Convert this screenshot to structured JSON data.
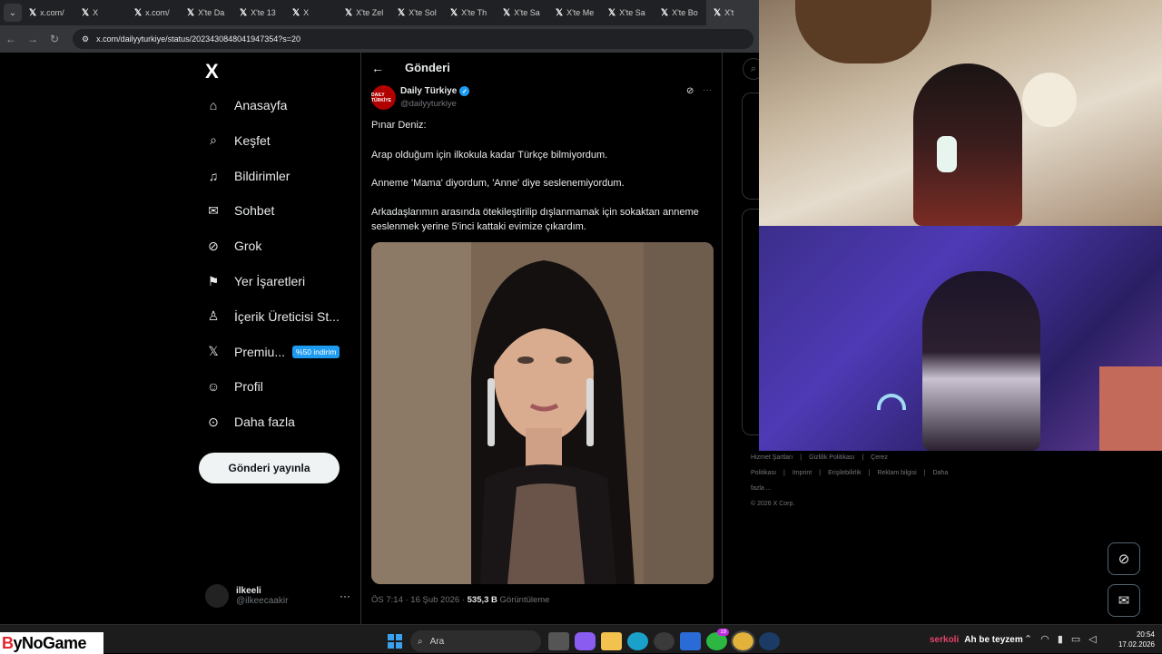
{
  "browser": {
    "tabs": [
      {
        "label": "x.com/"
      },
      {
        "label": "X"
      },
      {
        "label": "x.com/"
      },
      {
        "label": "X'te Da"
      },
      {
        "label": "X'te 13"
      },
      {
        "label": "X"
      },
      {
        "label": "X'te Zel"
      },
      {
        "label": "X'te Sol"
      },
      {
        "label": "X'te Th"
      },
      {
        "label": "X'te Sa"
      },
      {
        "label": "X'te Me"
      },
      {
        "label": "X'te Sa"
      },
      {
        "label": "X'te Bo"
      },
      {
        "label": "X't"
      }
    ],
    "url": "x.com/dailyyturkiye/status/2023430848041947354?s=20"
  },
  "leftnav": {
    "logo": "X",
    "items": [
      {
        "label": "Anasayfa",
        "icon": "home-icon"
      },
      {
        "label": "Keşfet",
        "icon": "search-icon"
      },
      {
        "label": "Bildirimler",
        "icon": "bell-icon"
      },
      {
        "label": "Sohbet",
        "icon": "mail-icon"
      },
      {
        "label": "Grok",
        "icon": "grok-icon"
      },
      {
        "label": "Yer İşaretleri",
        "icon": "bookmark-icon"
      },
      {
        "label": "İçerik Üreticisi St...",
        "icon": "creator-icon"
      },
      {
        "label": "Premiu...",
        "icon": "x-premium-icon"
      },
      {
        "label": "Profil",
        "icon": "person-icon"
      },
      {
        "label": "Daha fazla",
        "icon": "more-circle-icon"
      }
    ],
    "premium_badge": "%50 indirim",
    "post_button": "Gönderi yayınla",
    "account": {
      "name": "ilkeeli",
      "handle": "@ilkeecaakir"
    }
  },
  "post": {
    "header": "Gönderi",
    "author_name": "Daily Türkiye",
    "author_handle": "@dailyyturkiye",
    "avatar_text": "DAILY TÜRKİYE",
    "paragraphs": [
      "Pınar Deniz:",
      "Arap olduğum için ilkokula kadar Türkçe bilmiyordum.",
      "Anneme 'Mama' diyordum, 'Anne' diye seslenemiyordum.",
      "Arkadaşlarımın arasında ötekileştirilip dışlanmamak için sokaktan anneme seslenmek yerine 5'inci kattaki evimize çıkardım."
    ],
    "time": "ÖS 7:14 · 16 Şub 2026 · ",
    "views": "535,3 B",
    "views_label": " Görüntüleme"
  },
  "right": {
    "footer_links": [
      "Hizmet Şartları",
      "|",
      "Gizlilik Politikası",
      "|",
      "Çerez Politikası",
      "|",
      "Imprint",
      "|",
      "Erişilebilirlik",
      "|",
      "Reklam bilgisi",
      "|",
      "Daha fazla ..."
    ],
    "copyright": "© 2026 X Corp."
  },
  "taskbar": {
    "brand_a": "B",
    "brand_b": "yNoGame",
    "search": "Ara",
    "badge": "19",
    "chat_user": "serkoli",
    "chat_message": "Ah be teyzem",
    "time": "20:54",
    "date": "17.02.2026"
  },
  "colors": {
    "accent": "#1d9bf0",
    "background": "#000000",
    "muted": "#71767b",
    "chat_user": "#e5436a"
  }
}
